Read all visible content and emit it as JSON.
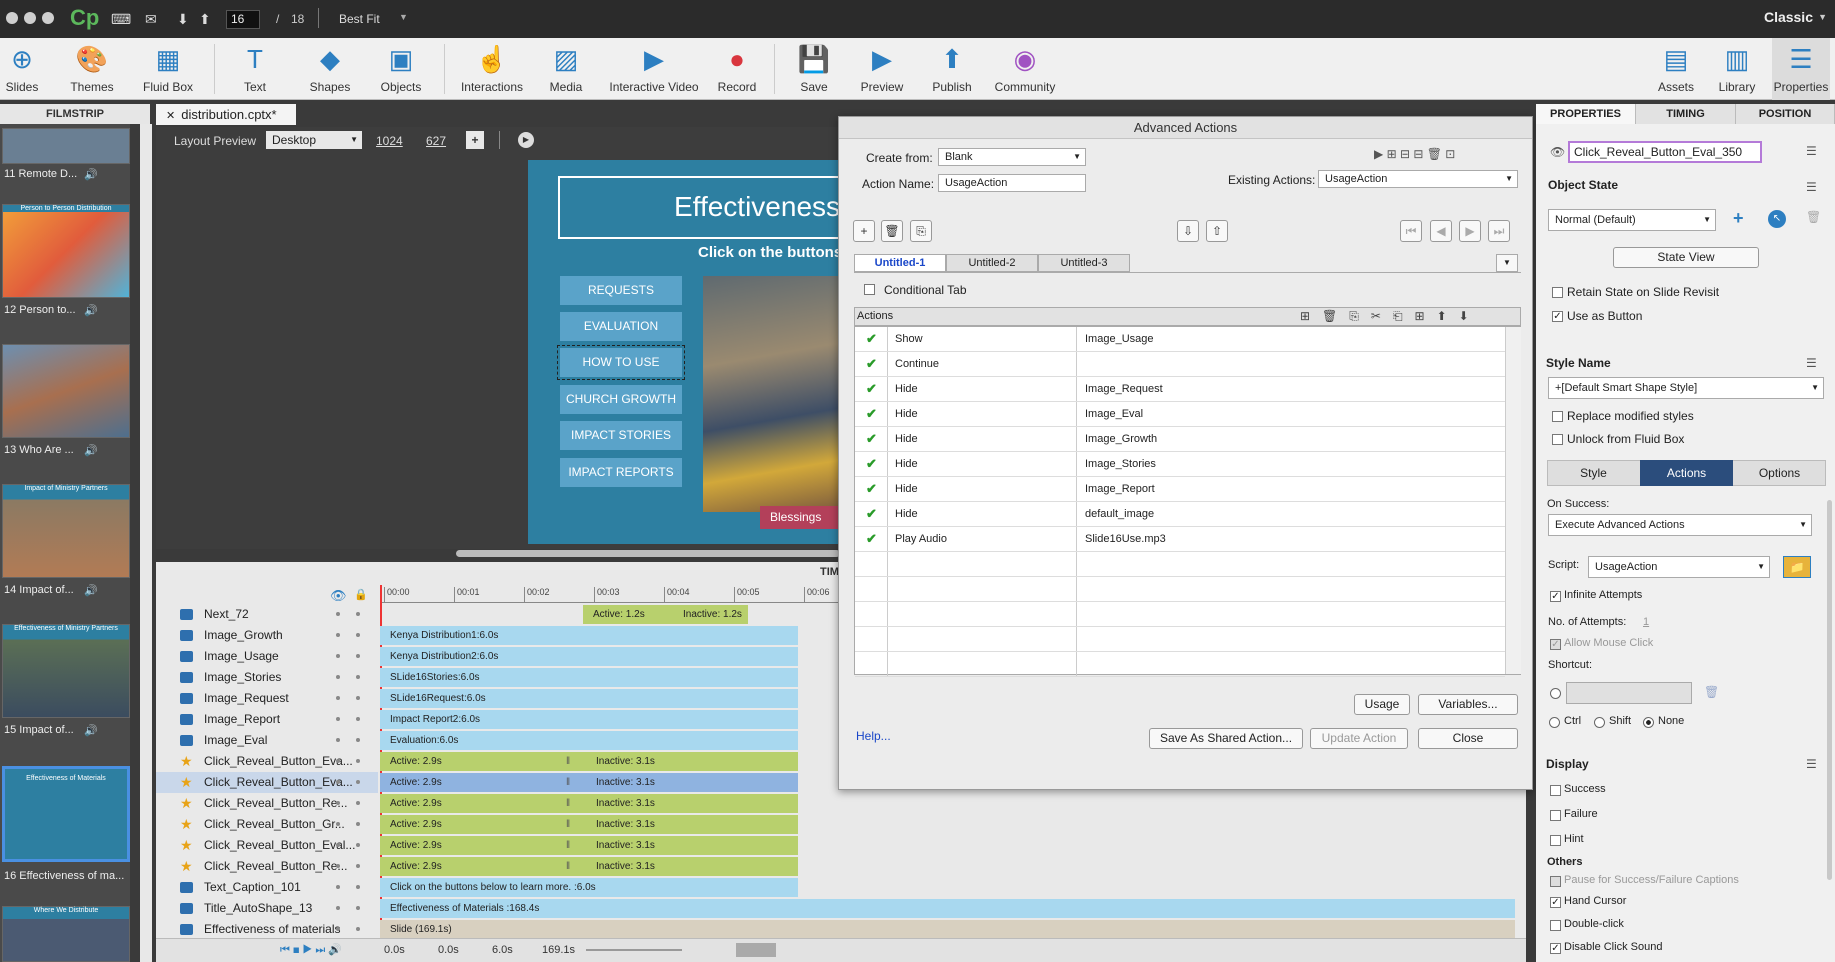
{
  "titlebar": {
    "page_current": "16",
    "page_sep": "/",
    "page_total": "18",
    "fit": "Best Fit",
    "mode": "Classic"
  },
  "toolbar": [
    {
      "label": "Slides",
      "icon": "plus-circle-icon"
    },
    {
      "label": "Themes",
      "icon": "palette-icon"
    },
    {
      "label": "Fluid Box",
      "icon": "fluid-box-icon"
    },
    {
      "label": "Text",
      "icon": "text-icon"
    },
    {
      "label": "Shapes",
      "icon": "shapes-icon"
    },
    {
      "label": "Objects",
      "icon": "objects-icon"
    },
    {
      "label": "Interactions",
      "icon": "hand-pointer-icon"
    },
    {
      "label": "Media",
      "icon": "image-icon"
    },
    {
      "label": "Interactive Video",
      "icon": "video-icon"
    },
    {
      "label": "Record",
      "icon": "microphone-icon"
    },
    {
      "label": "Save",
      "icon": "save-icon"
    },
    {
      "label": "Preview",
      "icon": "play-icon"
    },
    {
      "label": "Publish",
      "icon": "publish-icon"
    },
    {
      "label": "Community",
      "icon": "community-icon"
    },
    {
      "label": "Assets",
      "icon": "assets-icon"
    },
    {
      "label": "Library",
      "icon": "library-icon"
    },
    {
      "label": "Properties",
      "icon": "properties-icon"
    }
  ],
  "filmstrip": {
    "header": "FILMSTRIP",
    "slides": [
      {
        "label": "11 Remote D...",
        "title": ""
      },
      {
        "label": "12 Person to...",
        "title": "Person to Person Distribution"
      },
      {
        "label": "13 Who Are ...",
        "title": ""
      },
      {
        "label": "14 Impact of...",
        "title": "Impact of Ministry Partners"
      },
      {
        "label": "15 Impact of...",
        "title": "Effectiveness of Ministry Partners"
      },
      {
        "label": "16 Effectiveness of ma...",
        "title": "Effectiveness of Materials"
      },
      {
        "label": "",
        "title": "Where We Distribute"
      }
    ]
  },
  "document": {
    "tab": "distribution.cptx*",
    "layout_preview": "Layout Preview",
    "device": "Desktop",
    "width": "1024",
    "height": "627"
  },
  "slide": {
    "title": "Effectiveness",
    "subtitle": "Click on the buttons",
    "buttons": [
      "REQUESTS",
      "EVALUATION",
      "HOW TO USE",
      "CHURCH GROWTH",
      "IMPACT STORIES",
      "IMPACT REPORTS"
    ],
    "image_caption": "Blessings"
  },
  "timeline": {
    "header": "TIM",
    "ticks": [
      "00:00",
      "00:01",
      "00:02",
      "00:03",
      "00:04",
      "00:05",
      "00:06"
    ],
    "rows": [
      {
        "name": "Next_72",
        "bar": "",
        "active": "Active: 1.2s",
        "inactive": "Inactive: 1.2s"
      },
      {
        "name": "Image_Growth",
        "bar": "Kenya Distribution1:6.0s"
      },
      {
        "name": "Image_Usage",
        "bar": "Kenya Distribution2:6.0s"
      },
      {
        "name": "Image_Stories",
        "bar": "SLide16Stories:6.0s"
      },
      {
        "name": "Image_Request",
        "bar": "SLide16Request:6.0s"
      },
      {
        "name": "Image_Report",
        "bar": "Impact Report2:6.0s"
      },
      {
        "name": "Image_Eval",
        "bar": "Evaluation:6.0s"
      },
      {
        "name": "Click_Reveal_Button_Eva...",
        "active": "Active: 2.9s",
        "inactive": "Inactive: 3.1s"
      },
      {
        "name": "Click_Reveal_Button_Eva...",
        "active": "Active: 2.9s",
        "inactive": "Inactive: 3.1s"
      },
      {
        "name": "Click_Reveal_Button_Re...",
        "active": "Active: 2.9s",
        "inactive": "Inactive: 3.1s"
      },
      {
        "name": "Click_Reveal_Button_Gr...",
        "active": "Active: 2.9s",
        "inactive": "Inactive: 3.1s"
      },
      {
        "name": "Click_Reveal_Button_Eval...",
        "active": "Active: 2.9s",
        "inactive": "Inactive: 3.1s"
      },
      {
        "name": "Click_Reveal_Button_Re...",
        "active": "Active: 2.9s",
        "inactive": "Inactive: 3.1s"
      },
      {
        "name": "Text_Caption_101",
        "bar": "Click on the buttons below to learn more. :6.0s"
      },
      {
        "name": "Title_AutoShape_13",
        "bar": "Effectiveness of Materials :168.4s"
      },
      {
        "name": "Effectiveness of materials",
        "bar": "Slide (169.1s)"
      }
    ],
    "footer": {
      "t1": "0.0s",
      "t2": "0.0s",
      "t3": "6.0s",
      "t4": "169.1s"
    }
  },
  "dialog": {
    "title": "Advanced Actions",
    "create_from_label": "Create from:",
    "create_from_value": "Blank",
    "action_name_label": "Action Name:",
    "action_name_value": "UsageAction",
    "existing_label": "Existing Actions:",
    "existing_value": "UsageAction",
    "tabs": [
      "Untitled-1",
      "Untitled-2",
      "Untitled-3"
    ],
    "conditional_tab": "Conditional Tab",
    "actions_header": "Actions",
    "actions": [
      {
        "action": "Show",
        "target": "Image_Usage"
      },
      {
        "action": "Continue",
        "target": ""
      },
      {
        "action": "Hide",
        "target": "Image_Request"
      },
      {
        "action": "Hide",
        "target": "Image_Eval"
      },
      {
        "action": "Hide",
        "target": "Image_Growth"
      },
      {
        "action": "Hide",
        "target": "Image_Stories"
      },
      {
        "action": "Hide",
        "target": "Image_Report"
      },
      {
        "action": "Hide",
        "target": "default_image"
      },
      {
        "action": "Play Audio",
        "target": "Slide16Use.mp3"
      }
    ],
    "help": "Help...",
    "usage": "Usage",
    "variables": "Variables...",
    "save_shared": "Save As Shared Action...",
    "update": "Update Action",
    "close": "Close"
  },
  "properties": {
    "tabs": [
      "PROPERTIES",
      "TIMING",
      "POSITION"
    ],
    "name": "Click_Reveal_Button_Eval_350",
    "object_state": "Object State",
    "state_value": "Normal (Default)",
    "state_view": "State View",
    "retain_state": "Retain State on Slide Revisit",
    "use_as_button": "Use as Button",
    "style_name": "Style Name",
    "style_value": "+[Default Smart Shape Style]",
    "replace_styles": "Replace modified styles",
    "unlock_fluid": "Unlock from Fluid Box",
    "subtabs": [
      "Style",
      "Actions",
      "Options"
    ],
    "on_success_label": "On Success:",
    "on_success_value": "Execute Advanced Actions",
    "script_label": "Script:",
    "script_value": "UsageAction",
    "infinite": "Infinite Attempts",
    "attempts_label": "No. of Attempts:",
    "attempts_value": "1",
    "allow_mouse": "Allow Mouse Click",
    "shortcut": "Shortcut:",
    "ctrl": "Ctrl",
    "shift": "Shift",
    "none": "None",
    "display": "Display",
    "success": "Success",
    "failure": "Failure",
    "hint": "Hint",
    "others": "Others",
    "pause": "Pause for Success/Failure Captions",
    "hand_cursor": "Hand Cursor",
    "double_click": "Double-click",
    "disable_sound": "Disable Click Sound"
  }
}
